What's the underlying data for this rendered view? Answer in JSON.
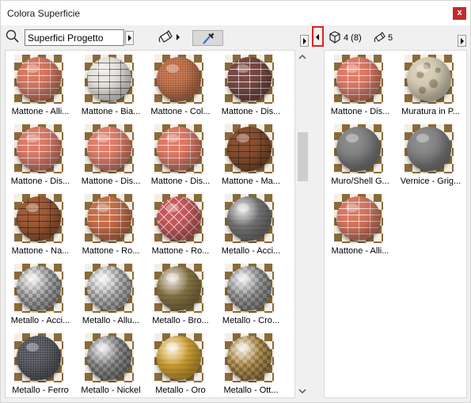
{
  "window": {
    "title": "Colora Superficie",
    "close_label": "x"
  },
  "search": {
    "value": "Superfici Progetto"
  },
  "right_header": {
    "object_count": "4 (8)",
    "surface_count": "5"
  },
  "colors": {
    "close_button": "#c42b2b",
    "highlight_border": "#e02020"
  },
  "left_tiles": [
    {
      "label": "Mattone - Alli...",
      "color": "#d77a62",
      "texture": "brick"
    },
    {
      "label": "Mattone - Bia...",
      "color": "#ebe9e6",
      "texture": "brick-dark"
    },
    {
      "label": "Mattone - Col...",
      "color": "#b9673d",
      "texture": "speck"
    },
    {
      "label": "Mattone - Dis...",
      "color": "#7a4a45",
      "texture": "brick"
    },
    {
      "label": "Mattone - Dis...",
      "color": "#dd7d6a",
      "texture": "brick"
    },
    {
      "label": "Mattone - Dis...",
      "color": "#e0806b",
      "texture": "brick"
    },
    {
      "label": "Mattone - Dis...",
      "color": "#df7b66",
      "texture": "brick"
    },
    {
      "label": "Mattone - Ma...",
      "color": "#8a5132",
      "texture": "brick-dark"
    },
    {
      "label": "Mattone - Na...",
      "color": "#a15d37",
      "texture": "brick-dark"
    },
    {
      "label": "Mattone - Ro...",
      "color": "#c9714a",
      "texture": "brick"
    },
    {
      "label": "Mattone - Ro...",
      "color": "#c8595a",
      "texture": "herring"
    },
    {
      "label": "Metallo - Acci...",
      "color": "#7a7a7a",
      "texture": "metal"
    },
    {
      "label": "Metallo - Acci...",
      "color": "#b8b8b8",
      "texture": "checker"
    },
    {
      "label": "Metallo - Allu...",
      "color": "#c8c8c8",
      "texture": "checker"
    },
    {
      "label": "Metallo - Bro...",
      "color": "#8e7a4a",
      "texture": "metal"
    },
    {
      "label": "Metallo - Cro...",
      "color": "#a9a9a9",
      "texture": "checker"
    },
    {
      "label": "Metallo - Ferro",
      "color": "#4b4e55",
      "texture": "speck"
    },
    {
      "label": "Metallo - Nickel",
      "color": "#9a9a9a",
      "texture": "checker"
    },
    {
      "label": "Metallo - Oro",
      "color": "#d6a636",
      "texture": "metal"
    },
    {
      "label": "Metallo - Ott...",
      "color": "#c4a05a",
      "texture": "checker"
    }
  ],
  "right_tiles": [
    {
      "label": "Mattone - Dis...",
      "color": "#df7c68",
      "texture": "brick"
    },
    {
      "label": "Muratura in P...",
      "color": "#d8cfb8",
      "texture": "stone"
    },
    {
      "label": "Muro/Shell G...",
      "color": "#7c7c7c",
      "texture": "shade"
    },
    {
      "label": "Vernice - Grig...",
      "color": "#7e7e7e",
      "texture": "shade"
    },
    {
      "label": "Mattone - Alli...",
      "color": "#d77a62",
      "texture": "brick"
    }
  ]
}
